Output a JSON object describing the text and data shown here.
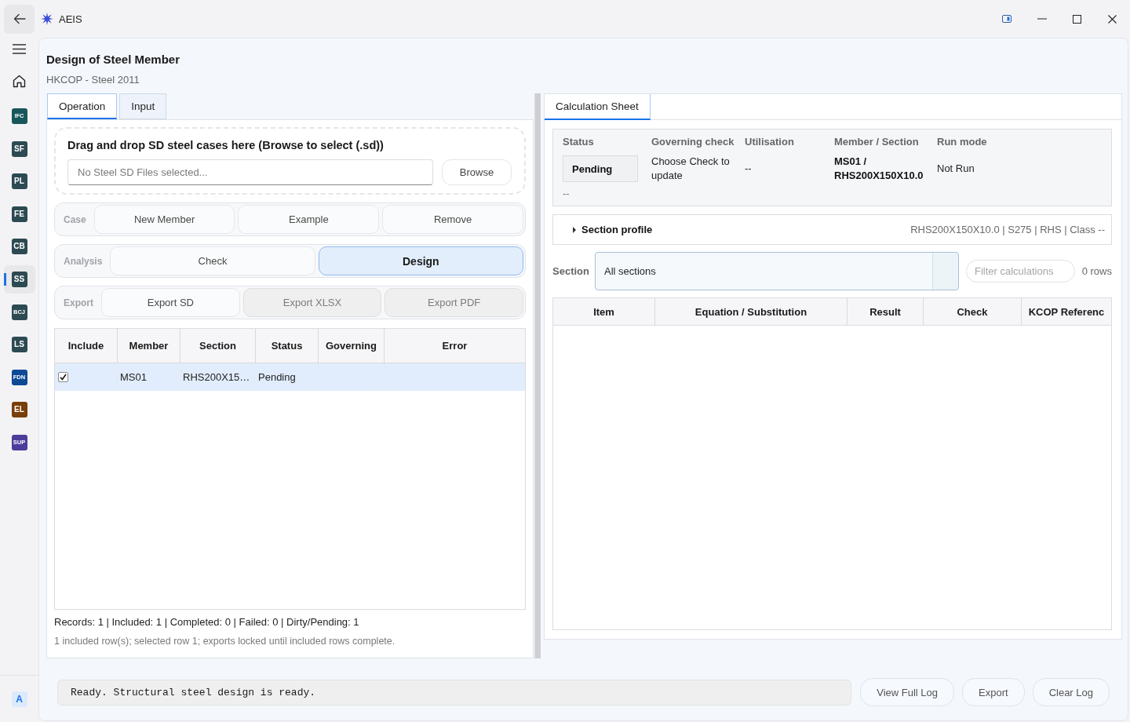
{
  "title_bar": {
    "app_name": "AEIS"
  },
  "sidebar": {
    "items": [
      {
        "label": "IFC",
        "color": "#17575b",
        "selected": false
      },
      {
        "label": "SF",
        "color": "#2c4a52",
        "selected": false
      },
      {
        "label": "PL",
        "color": "#2c4a52",
        "selected": false
      },
      {
        "label": "FE",
        "color": "#2c4a52",
        "selected": false
      },
      {
        "label": "CB",
        "color": "#2c4a52",
        "selected": false
      },
      {
        "label": "SS",
        "color": "#2c4a52",
        "selected": true
      },
      {
        "label": "BCJ",
        "color": "#2c4a52",
        "selected": false
      },
      {
        "label": "LS",
        "color": "#2c4a52",
        "selected": false
      },
      {
        "label": "FDN",
        "color": "#0d4a96",
        "selected": false
      },
      {
        "label": "EL",
        "color": "#7a3e08",
        "selected": false
      },
      {
        "label": "SUP",
        "color": "#4b3d9c",
        "selected": false
      }
    ],
    "account": "A"
  },
  "page": {
    "title": "Design of Steel Member",
    "subtitle": "HKCOP - Steel 2011"
  },
  "left_pane": {
    "tabs": [
      {
        "label": "Operation",
        "selected": true
      },
      {
        "label": "Input",
        "selected": false
      }
    ],
    "drop_zone": {
      "title": "Drag and drop SD steel cases here (Browse to select (.sd))",
      "placeholder": "No Steel SD Files selected...",
      "browse_button": "Browse"
    },
    "action_groups": [
      {
        "label": "Case",
        "buttons": [
          {
            "label": "New Member",
            "selected": false,
            "disabled": false
          },
          {
            "label": "Example",
            "selected": false,
            "disabled": false
          },
          {
            "label": "Remove",
            "selected": false,
            "disabled": false
          }
        ]
      },
      {
        "label": "Analysis",
        "buttons": [
          {
            "label": "Check",
            "selected": false,
            "disabled": false
          },
          {
            "label": "Design",
            "selected": true,
            "disabled": false
          }
        ]
      },
      {
        "label": "Export",
        "buttons": [
          {
            "label": "Export SD",
            "selected": false,
            "disabled": false
          },
          {
            "label": "Export XLSX",
            "selected": false,
            "disabled": true
          },
          {
            "label": "Export PDF",
            "selected": false,
            "disabled": true
          }
        ]
      }
    ],
    "members_table": {
      "columns": [
        "Include",
        "Member",
        "Section",
        "Status",
        "Governing",
        "Error"
      ],
      "rows": [
        {
          "include": true,
          "selected": true,
          "cells": [
            "",
            "MS01",
            "RHS200X15…",
            "Pending"
          ]
        }
      ]
    },
    "records_summary": "Records: 1 | Included: 1 | Completed: 0 | Failed: 0 | Dirty/Pending: 1",
    "status_note": "1 included row(s); selected row 1; exports locked until included rows complete."
  },
  "right_pane": {
    "tabs": [
      {
        "label": "Calculation Sheet",
        "selected": true
      }
    ],
    "summary": {
      "fields": [
        {
          "label": "Status",
          "value": "Pending",
          "kind": "badge"
        },
        {
          "label": "Governing check",
          "value": "Choose Check to update",
          "kind": "text"
        },
        {
          "label": "Utilisation",
          "value": "--",
          "kind": "text"
        },
        {
          "label": "Member / Section",
          "value": "MS01 / RHS200X150X10.0",
          "kind": "strong"
        },
        {
          "label": "Run mode",
          "value": "Not Run",
          "kind": "text"
        }
      ],
      "footnote": "--"
    },
    "section_profile": {
      "title": "Section profile",
      "expanded": false,
      "details": "RHS200X150X10.0 | S275 | RHS | Class --"
    },
    "filter": {
      "label": "Section",
      "dropdown": "All sections",
      "search": {
        "placeholder": "Filter calculations"
      },
      "row_count": "0 rows"
    },
    "calc_table": {
      "columns": [
        "Item",
        "Equation / Substitution",
        "Result",
        "Check",
        "KCOP Referenc"
      ]
    }
  },
  "log_bar": {
    "message": "Ready. Structural steel design is ready.",
    "buttons": [
      "View Full Log",
      "Export",
      "Clear Log"
    ]
  }
}
